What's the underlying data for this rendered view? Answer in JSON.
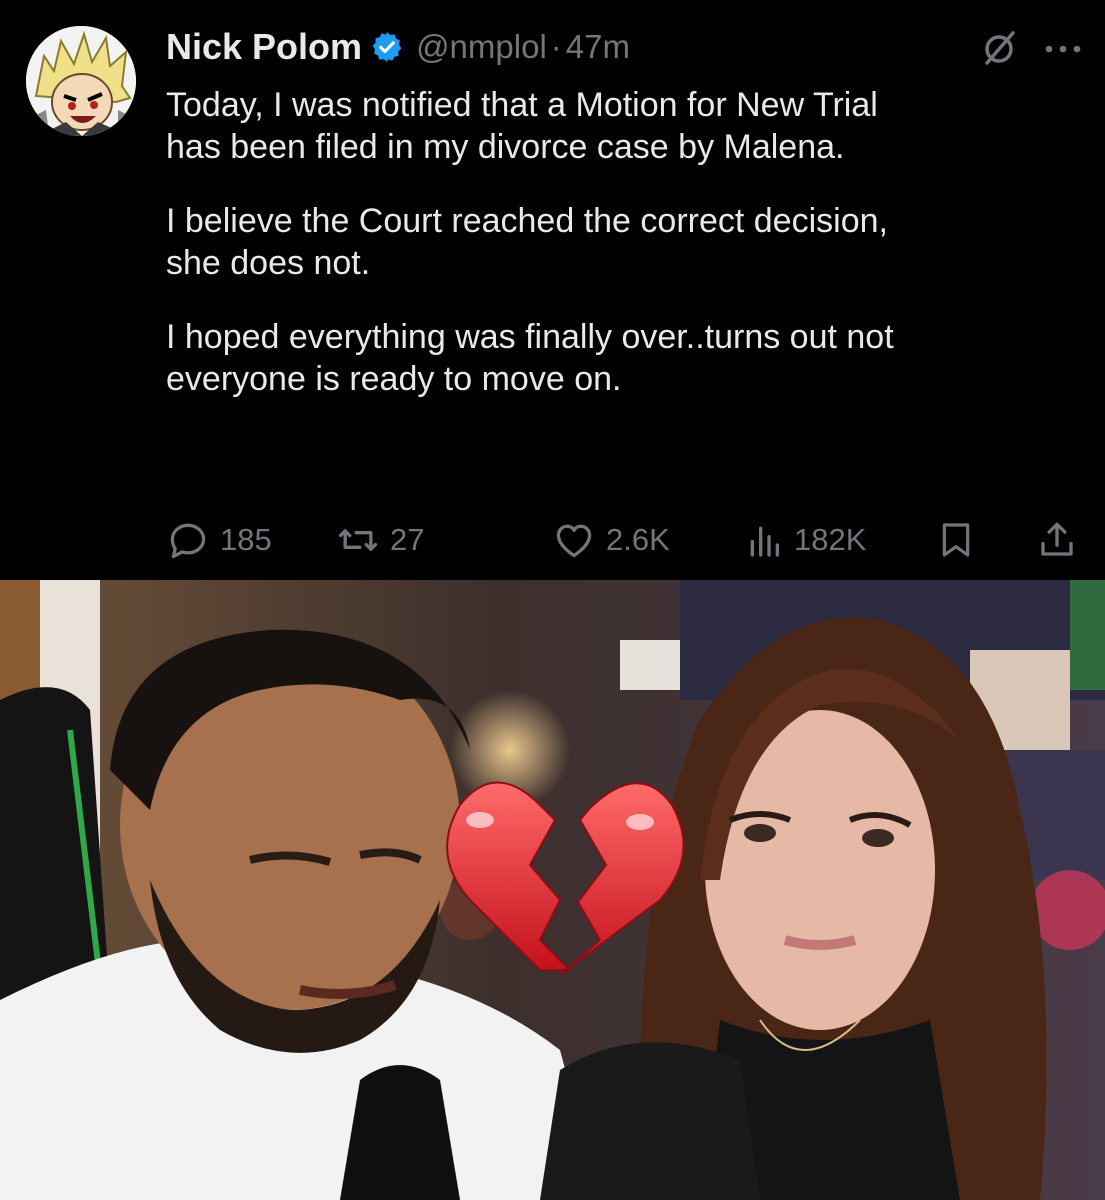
{
  "tweet": {
    "author_name": "Nick Polom",
    "handle": "@nmplol",
    "separator": "·",
    "time": "47m",
    "paragraphs": [
      "Today, I was notified that a Motion for New Trial\nhas been filed in my divorce case by Malena.",
      "I believe the Court reached the correct decision,\nshe does not.",
      "I hoped everything was finally over..turns out not\neveryone is ready to move on."
    ],
    "actions": {
      "replies": "185",
      "reposts": "27",
      "likes": "2.6K",
      "views": "182K"
    },
    "icons": {
      "verified": "verified-badge-icon",
      "grok": "grok-icon",
      "more": "more-icon",
      "reply": "reply-icon",
      "repost": "repost-icon",
      "like": "heart-icon",
      "views": "views-icon",
      "bookmark": "bookmark-icon",
      "share": "share-icon"
    }
  },
  "colors": {
    "background": "#000000",
    "text": "#e7e9ea",
    "muted": "#71767b",
    "verified": "#1d9bf0",
    "heart_emoji": "#e0262f"
  },
  "media": {
    "emoji": "broken-heart"
  }
}
